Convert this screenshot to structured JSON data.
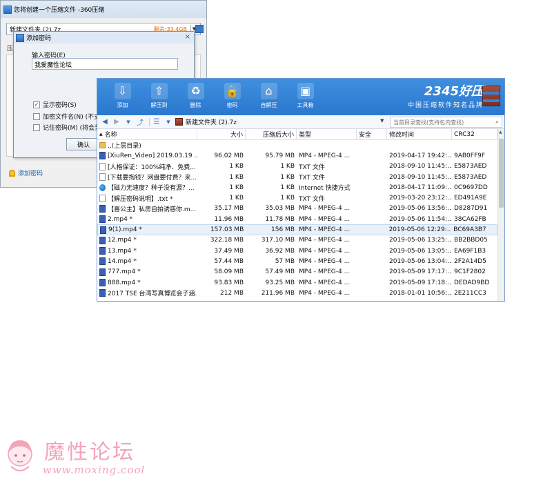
{
  "win360": {
    "title": "您将创建一个压缩文件 -360压缩",
    "path_value": "新建文件夹 (2).7z",
    "free_space": "剩余:33.4GB",
    "side_label": "压",
    "add_password_link": "添加密码"
  },
  "password_dialog": {
    "title": "添加密码",
    "close": "×",
    "input_label": "输入密码(E)",
    "password_value": "我爱魔性论坛",
    "show_password": "显示密码(S)",
    "show_password_checked": true,
    "encrypt_names": "加密文件名(N) (不支",
    "encrypt_names_checked": false,
    "remember_password": "记住密码(M) (将会显",
    "remember_password_checked": false,
    "ok_label": "确认"
  },
  "win2345": {
    "toolbar": [
      {
        "label": "添加",
        "icon": "add-icon"
      },
      {
        "label": "解压到",
        "icon": "extract-to-icon"
      },
      {
        "label": "删除",
        "icon": "delete-icon"
      },
      {
        "label": "密码",
        "icon": "password-icon"
      },
      {
        "label": "自解压",
        "icon": "self-extract-icon"
      },
      {
        "label": "工具箱",
        "icon": "toolbox-icon"
      }
    ],
    "brand_logo": "2345好压",
    "brand_slogan": "中国压缩软件知名品牌",
    "nav_path": "新建文件夹 (2).7z",
    "search_placeholder": "当前目录查找(支持包内查找)",
    "columns": [
      "名称",
      "大小",
      "压缩后大小",
      "类型",
      "安全",
      "修改时间",
      "CRC32"
    ],
    "parent_dir": "..(上层目录)",
    "rows": [
      {
        "name": "[XiuRen_Video] 2019.03.19 ...",
        "size": "96.02 MB",
        "csize": "95.79 MB",
        "type": "MP4 - MPEG-4 ...",
        "time": "2019-04-17 19:42:...",
        "crc": "9AB0FF9F",
        "icon": "video"
      },
      {
        "name": "[人格保证：100%纯净、免费...",
        "size": "1 KB",
        "csize": "1 KB",
        "type": "TXT 文件",
        "time": "2018-09-10 11:45:...",
        "crc": "E5873AED",
        "icon": "txt"
      },
      {
        "name": "[下载要掏钱？网盘要付费？来...",
        "size": "1 KB",
        "csize": "1 KB",
        "type": "TXT 文件",
        "time": "2018-09-10 11:45:...",
        "crc": "E5873AED",
        "icon": "txt"
      },
      {
        "name": "【磁力无速度？种子没有源？...",
        "size": "1 KB",
        "csize": "1 KB",
        "type": "Internet 快捷方式",
        "time": "2018-04-17 11:09:...",
        "crc": "0C9697DD",
        "icon": "web"
      },
      {
        "name": "【解压密码说明】.txt *",
        "size": "1 KB",
        "csize": "1 KB",
        "type": "TXT 文件",
        "time": "2019-03-20 23:12:...",
        "crc": "ED491A9E",
        "icon": "txt"
      },
      {
        "name": "【喜公主】私房自拍诱惑你.m...",
        "size": "35.17 MB",
        "csize": "35.03 MB",
        "type": "MP4 - MPEG-4 ...",
        "time": "2019-05-06 13:56:...",
        "crc": "D8287D91",
        "icon": "video"
      },
      {
        "name": "2.mp4 *",
        "size": "11.96 MB",
        "csize": "11.78 MB",
        "type": "MP4 - MPEG-4 ...",
        "time": "2019-05-06 11:54:...",
        "crc": "38CA62FB",
        "icon": "video"
      },
      {
        "name": "9(1).mp4 *",
        "size": "157.03 MB",
        "csize": "156 MB",
        "type": "MP4 - MPEG-4 ...",
        "time": "2019-05-06 12:29:...",
        "crc": "BC69A3B7",
        "icon": "video",
        "selected": true
      },
      {
        "name": "12.mp4 *",
        "size": "322.18 MB",
        "csize": "317.10 MB",
        "type": "MP4 - MPEG-4 ...",
        "time": "2019-05-06 13:25:...",
        "crc": "BB2BBD05",
        "icon": "video"
      },
      {
        "name": "13.mp4 *",
        "size": "37.49 MB",
        "csize": "36.92 MB",
        "type": "MP4 - MPEG-4 ...",
        "time": "2019-05-06 13:05:...",
        "crc": "EA69F1B3",
        "icon": "video"
      },
      {
        "name": "14.mp4 *",
        "size": "57.44 MB",
        "csize": "57 MB",
        "type": "MP4 - MPEG-4 ...",
        "time": "2019-05-06 13:04:...",
        "crc": "2F2A14D5",
        "icon": "video"
      },
      {
        "name": "777.mp4 *",
        "size": "58.09 MB",
        "csize": "57.49 MB",
        "type": "MP4 - MPEG-4 ...",
        "time": "2019-05-09 17:17:...",
        "crc": "9C1F2802",
        "icon": "video"
      },
      {
        "name": "888.mp4 *",
        "size": "93.83 MB",
        "csize": "93.25 MB",
        "type": "MP4 - MPEG-4 ...",
        "time": "2019-05-09 17:18:...",
        "crc": "DEDAD9BD",
        "icon": "video"
      },
      {
        "name": "2017 TSE 台湾写真博览会子涵...",
        "size": "212 MB",
        "csize": "211.96 MB",
        "type": "MP4 - MPEG-4 ...",
        "time": "2018-01-01 10:56:...",
        "crc": "2E211CC3",
        "icon": "video"
      }
    ]
  },
  "watermark": {
    "name": "魔性论坛",
    "url": "www.moxing.cool"
  },
  "colors": {
    "toolbar_blue": "#2a78cf",
    "selected_row": "#e8f1fb",
    "free_space_orange": "#e07000",
    "watermark_pink": "#f2a5b8"
  }
}
